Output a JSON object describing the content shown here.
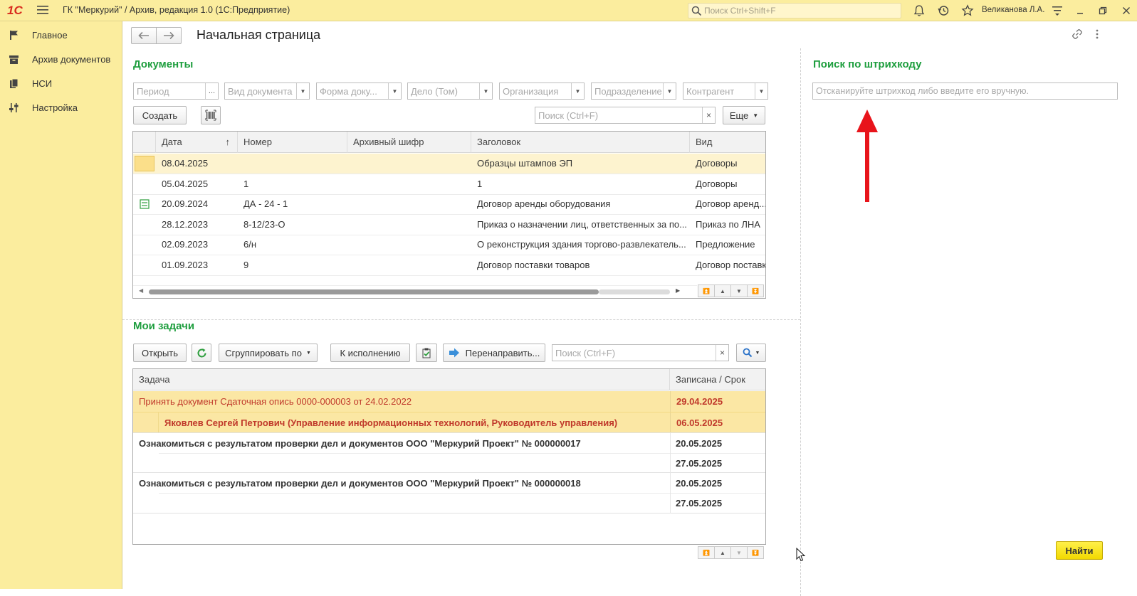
{
  "titlebar": {
    "logo": "1С",
    "title": "ГК \"Меркурий\" / Архив, редакция 1.0  (1С:Предприятие)",
    "search_placeholder": "Поиск Ctrl+Shift+F",
    "user": "Великанова Л.А."
  },
  "sidebar": {
    "items": [
      {
        "label": "Главное",
        "icon": "flag-icon"
      },
      {
        "label": "Архив документов",
        "icon": "archive-icon"
      },
      {
        "label": "НСИ",
        "icon": "books-icon"
      },
      {
        "label": "Настройка",
        "icon": "settings-sliders-icon"
      }
    ]
  },
  "page": {
    "title": "Начальная страница"
  },
  "documents": {
    "title": "Документы",
    "filters": [
      "Период",
      "Вид документа",
      "Форма доку...",
      "Дело (Том)",
      "Организация",
      "Подразделение",
      "Контрагент"
    ],
    "create_label": "Создать",
    "search_placeholder": "Поиск (Ctrl+F)",
    "more_label": "Еще",
    "columns": [
      "Дата",
      "Номер",
      "Архивный шифр",
      "Заголовок",
      "Вид"
    ],
    "rows": [
      {
        "date": "08.04.2025",
        "number": "",
        "code": "",
        "title": "Образцы штампов ЭП",
        "kind": "Договоры"
      },
      {
        "date": "05.04.2025",
        "number": "1",
        "code": "",
        "title": "1",
        "kind": "Договоры"
      },
      {
        "date": "20.09.2024",
        "number": "ДА - 24 - 1",
        "code": "",
        "title": "Договор аренды оборудования",
        "kind": "Договор аренд..."
      },
      {
        "date": "28.12.2023",
        "number": "8-12/23-О",
        "code": "",
        "title": "Приказ о назначении лиц, ответственных за по...",
        "kind": "Приказ по ЛНА"
      },
      {
        "date": "02.09.2023",
        "number": "6/н",
        "code": "",
        "title": "О реконструкция здания торгово-развлекатель...",
        "kind": "Предложение"
      },
      {
        "date": "01.09.2023",
        "number": "9",
        "code": "",
        "title": "Договор поставки товаров",
        "kind": "Договор поставк"
      }
    ]
  },
  "tasks": {
    "title": "Мои задачи",
    "open_label": "Открыть",
    "group_label": "Сгруппировать по",
    "execute_label": "К исполнению",
    "redirect_label": "Перенаправить...",
    "search_placeholder": "Поиск (Ctrl+F)",
    "columns": [
      "Задача",
      "Записана / Срок"
    ],
    "rows": [
      {
        "text": "Принять документ Сдаточная опись 0000-000003 от 24.02.2022",
        "date1": "29.04.2025",
        "date2": ""
      },
      {
        "text": "Яковлев Сергей Петрович (Управление информационных технологий, Руководитель управления)",
        "date1": "06.05.2025",
        "date2": ""
      },
      {
        "text": "Ознакомиться с результатом проверки дел и документов ООО \"Меркурий Проект\" № 000000017",
        "date1": "20.05.2025",
        "date2": "27.05.2025"
      },
      {
        "text": "Ознакомиться с результатом проверки дел и документов ООО \"Меркурий Проект\" № 000000018",
        "date1": "20.05.2025",
        "date2": "27.05.2025"
      }
    ]
  },
  "barcode": {
    "title": "Поиск по штрихкоду",
    "placeholder": "Отсканируйте штрихкод либо введите его вручную.",
    "find_label": "Найти"
  },
  "colors": {
    "accent_yellow": "#fbed9e",
    "section_green": "#1e9e3e",
    "task_red": "#c0392b",
    "highlight_row": "#fbe7a4",
    "arrow_red": "#e8141b"
  }
}
